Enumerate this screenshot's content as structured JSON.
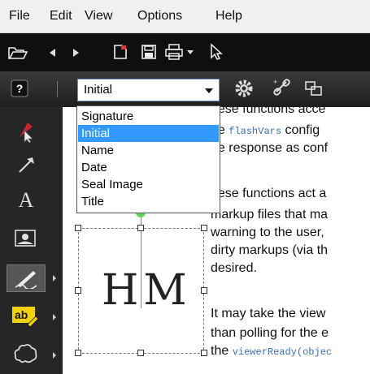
{
  "menu": [
    "File",
    "Edit",
    "View",
    "Options",
    "Help"
  ],
  "markup_select": {
    "value": "Initial"
  },
  "dropdown_options": [
    {
      "label": "Signature",
      "selected": false
    },
    {
      "label": "Initial",
      "selected": true
    },
    {
      "label": "Name",
      "selected": false
    },
    {
      "label": "Date",
      "selected": false
    },
    {
      "label": "Seal Image",
      "selected": false
    },
    {
      "label": "Title",
      "selected": false
    }
  ],
  "doc_text": {
    "l1": "hese functions acce",
    "l2a": "he ",
    "l2code": "flashVars",
    "l2b": " config",
    "l3": "he response as conf",
    "l4": "hese functions act a",
    "l5": "markup files that ma",
    "l6": "warning to the user,",
    "l7": "dirty markups (via th",
    "l8": "desired.",
    "l9": "It may take the view",
    "l10": "than polling for the e",
    "l11a": "the ",
    "l11code": "viewerReady(objec"
  },
  "initial_text": "HM",
  "colors": {
    "accent": "#3399ff",
    "handle_green": "#5fd35f"
  }
}
